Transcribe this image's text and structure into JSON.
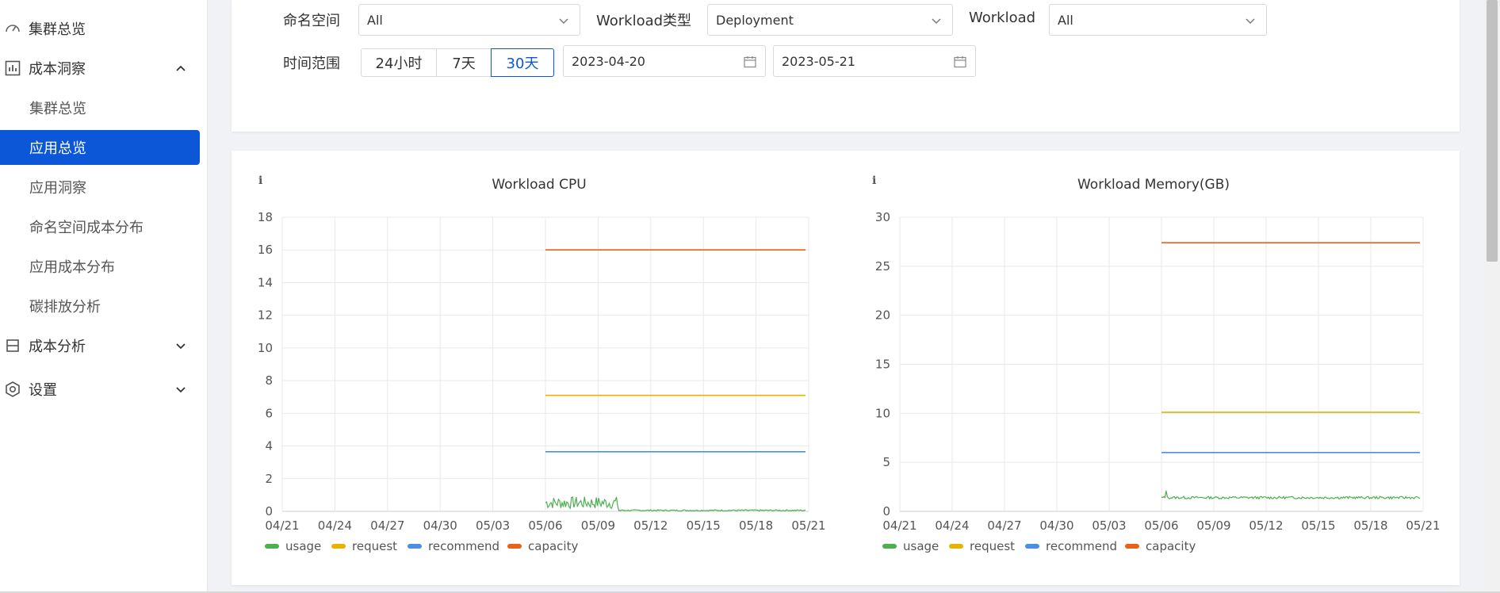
{
  "sidebar": {
    "items": [
      {
        "label": "集群总览",
        "icon": "speedometer-icon"
      },
      {
        "label": "成本洞察",
        "icon": "bar-chart-icon",
        "expanded": true,
        "children": [
          "集群总览",
          "应用总览",
          "应用洞察",
          "命名空间成本分布",
          "应用成本分布",
          "碳排放分析"
        ],
        "active_child": "应用总览"
      },
      {
        "label": "成本分析",
        "icon": "cost-box-icon",
        "expanded": false
      },
      {
        "label": "设置",
        "icon": "gear-icon",
        "expanded": false
      }
    ]
  },
  "filters": {
    "namespace_label": "命名空间",
    "namespace_value": "All",
    "workload_type_label": "Workload类型",
    "workload_type_value": "Deployment",
    "workload_label": "Workload",
    "workload_value": "All",
    "time_range_label": "时间范围",
    "time_options": [
      "24小时",
      "7天",
      "30天"
    ],
    "time_selected": "30天",
    "start_date": "2023-04-20",
    "end_date": "2023-05-21"
  },
  "colors": {
    "accent": "#0b57d8",
    "usage": "#4caf50",
    "request": "#e6b400",
    "recommend": "#4a90e2",
    "capacity": "#e8621a"
  },
  "chart_data": [
    {
      "type": "line",
      "title": "Workload CPU",
      "info_icon": "info-icon",
      "categories": [
        "04/21",
        "04/24",
        "04/27",
        "04/30",
        "05/03",
        "05/06",
        "05/09",
        "05/12",
        "05/15",
        "05/18",
        "05/21"
      ],
      "ylim": [
        0,
        18
      ],
      "yticks": [
        0,
        2,
        4,
        6,
        8,
        10,
        12,
        14,
        16,
        18
      ],
      "x_start": "05/06",
      "x_end": "05/21",
      "series": [
        {
          "name": "usage",
          "note_values": {
            "05/06-05/10": 0.6,
            "05/10-05/21": 0.05
          }
        },
        {
          "name": "request",
          "value": 7.1
        },
        {
          "name": "recommend",
          "value": 3.65
        },
        {
          "name": "capacity",
          "value": 16
        }
      ],
      "legend": [
        "usage",
        "request",
        "recommend",
        "capacity"
      ]
    },
    {
      "type": "line",
      "title": "Workload Memory(GB)",
      "info_icon": "info-icon",
      "categories": [
        "04/21",
        "04/24",
        "04/27",
        "04/30",
        "05/03",
        "05/06",
        "05/09",
        "05/12",
        "05/15",
        "05/18",
        "05/21"
      ],
      "ylim": [
        0,
        30
      ],
      "yticks": [
        0,
        5,
        10,
        15,
        20,
        25,
        30
      ],
      "x_start": "05/06",
      "x_end": "05/21",
      "series": [
        {
          "name": "usage",
          "value": 1.4
        },
        {
          "name": "request",
          "value": 10.1
        },
        {
          "name": "recommend",
          "value": 6
        },
        {
          "name": "capacity",
          "value": 27.4
        }
      ],
      "legend": [
        "usage",
        "request",
        "recommend",
        "capacity"
      ]
    }
  ]
}
